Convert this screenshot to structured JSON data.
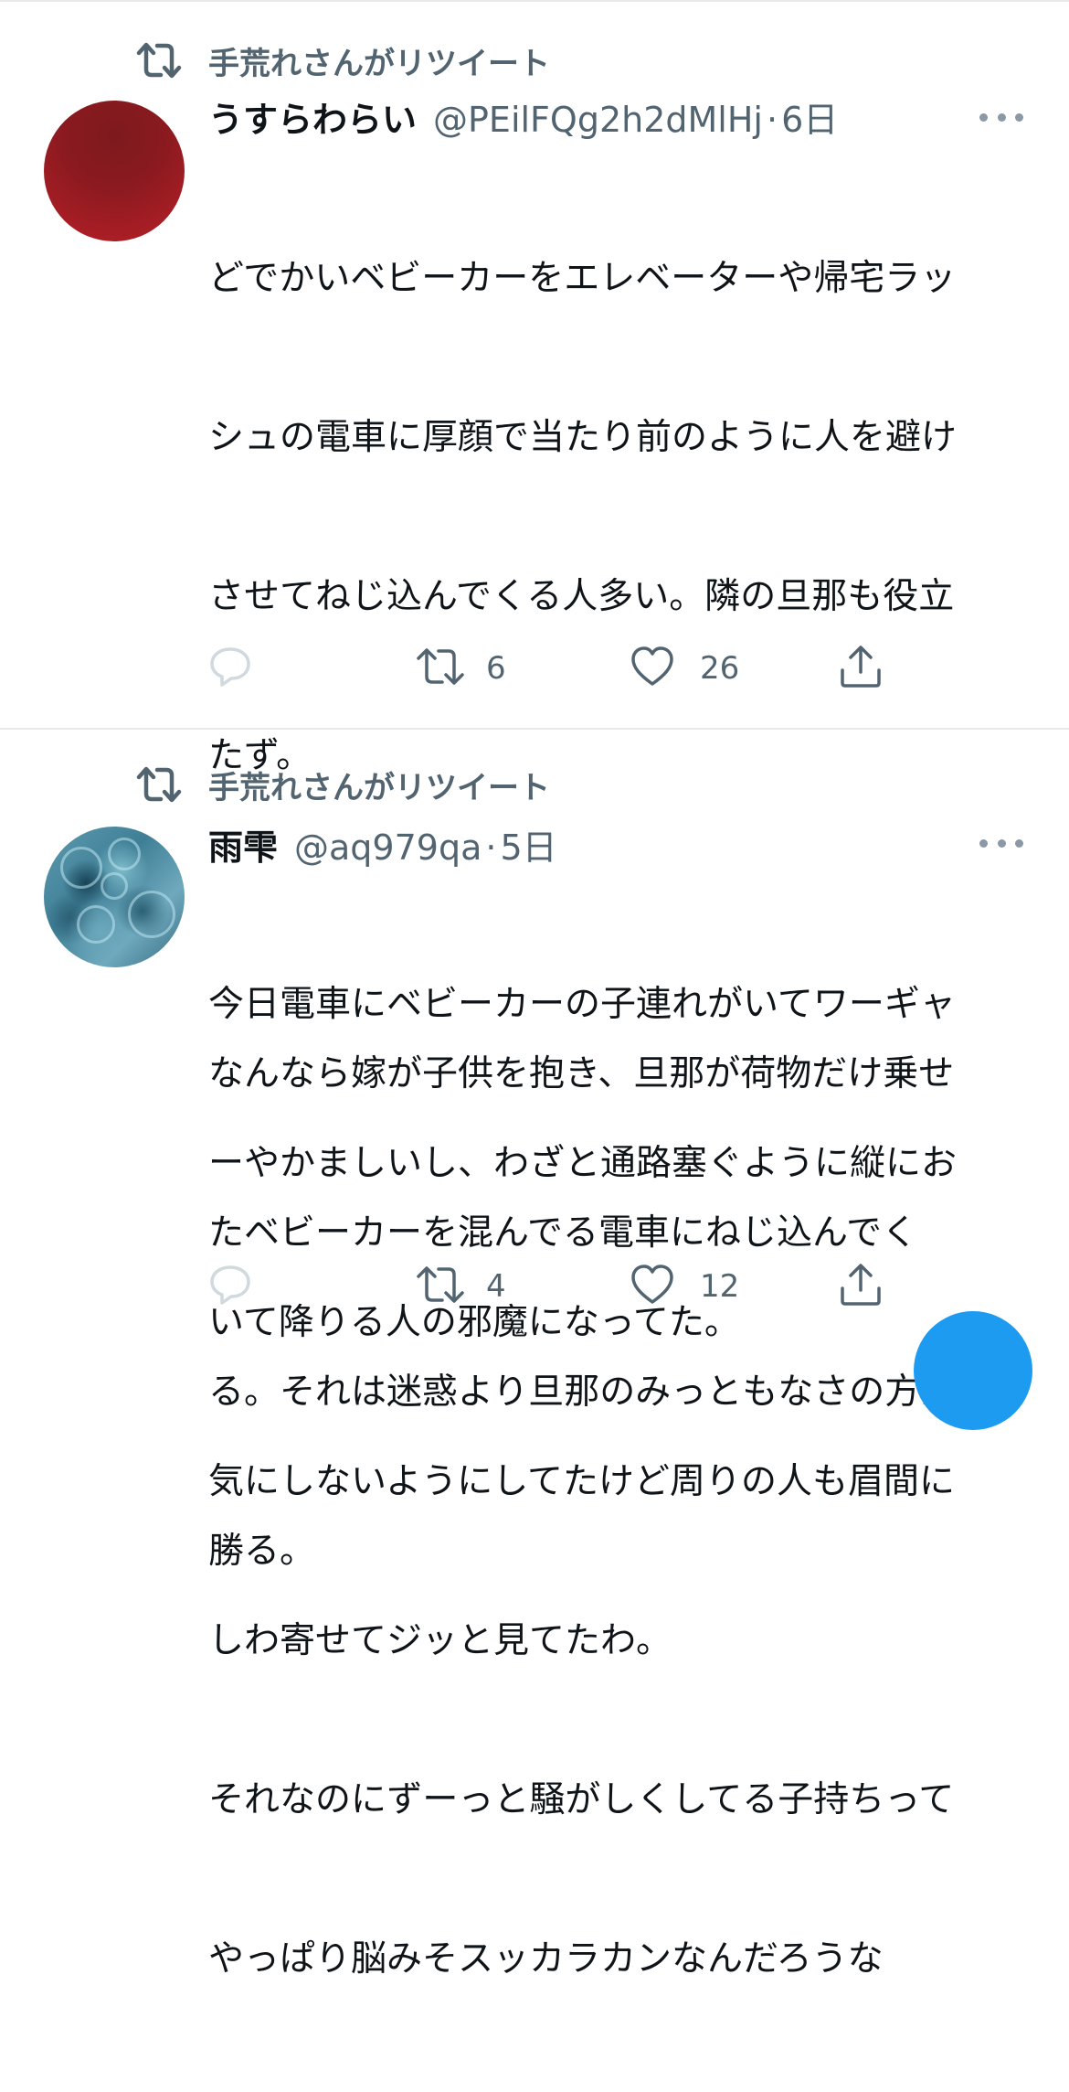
{
  "colors": {
    "text_primary": "#0f1419",
    "text_secondary": "#536471",
    "divider": "#e7e9ea",
    "accent": "#1d9bf0"
  },
  "tweets": [
    {
      "retweeted_by": "手荒れさんがリツイート",
      "display_name": "うすらわらい",
      "handle": "@PEilFQg2h2dMlHj",
      "separator": "·",
      "time": "6日",
      "text_lines": [
        "どでかいベビーカーをエレベーターや帰宅ラッ",
        "シュの電車に厚顔で当たり前のように人を避け",
        "させてねじ込んでくる人多い。隣の旦那も役立",
        "たず。",
        "",
        "なんなら嫁が子供を抱き、旦那が荷物だけ乗せ",
        "たベビーカーを混んでる電車にねじ込んでく",
        "る。それは迷惑より旦那のみっともなさの方が",
        "勝る。"
      ],
      "reply_count": "",
      "retweet_count": "6",
      "like_count": "26",
      "avatar_icon": "avatar-red-circle"
    },
    {
      "retweeted_by": "手荒れさんがリツイート",
      "display_name": "雨雫",
      "handle": "@aq979qa",
      "separator": "·",
      "time": "5日",
      "text_lines": [
        "今日電車にベビーカーの子連れがいてワーギャ",
        "ーやかましいし、わざと通路塞ぐように縦にお",
        "いて降りる人の邪魔になってた。",
        "気にしないようにしてたけど周りの人も眉間に",
        "しわ寄せてジッと見てたわ。",
        "それなのにずーっと騒がしくしてる子持ちって",
        "やっぱり脳みそスッカラカンなんだろうな"
      ],
      "reply_count": "",
      "retweet_count": "4",
      "like_count": "12",
      "avatar_icon": "avatar-blue-texture"
    }
  ],
  "icons": {
    "retweet": "retweet-icon",
    "reply": "reply-icon",
    "like": "heart-icon",
    "share": "share-icon",
    "more": "more-icon"
  }
}
